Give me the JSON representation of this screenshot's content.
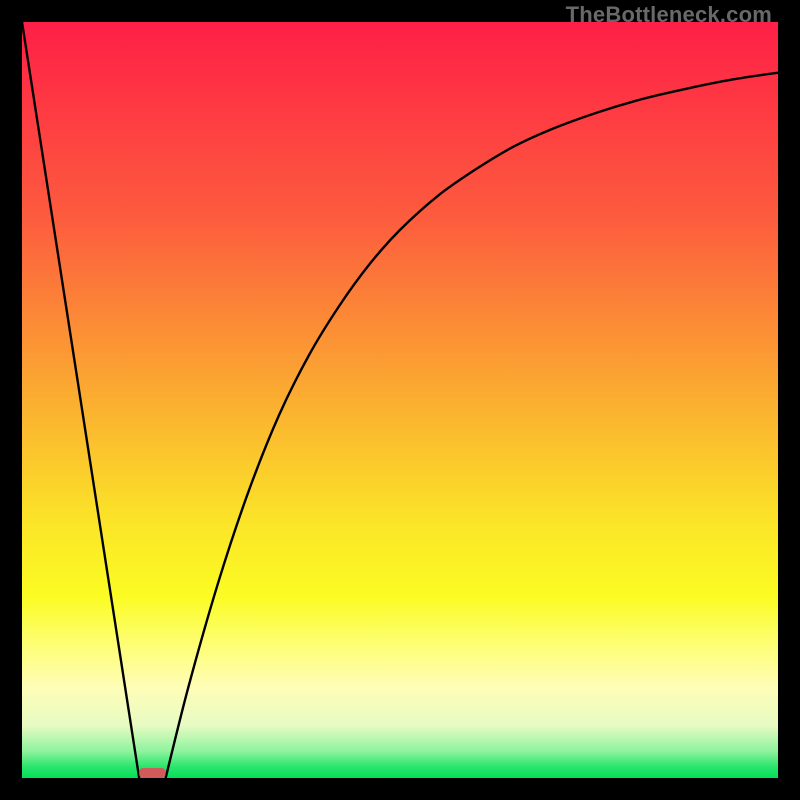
{
  "watermark": "TheBottleneck.com",
  "chart_data": {
    "type": "line",
    "title": "",
    "xlabel": "",
    "ylabel": "",
    "xlim": [
      0,
      100
    ],
    "ylim": [
      0,
      100
    ],
    "grid": false,
    "series": [
      {
        "name": "left-linear",
        "x": [
          0,
          15.5
        ],
        "values": [
          100,
          0
        ]
      },
      {
        "name": "right-curve",
        "x": [
          19,
          22,
          26,
          30,
          34,
          38,
          42,
          46,
          50,
          55,
          60,
          65,
          70,
          76,
          82,
          88,
          94,
          100
        ],
        "values": [
          0,
          12,
          26,
          38,
          48,
          56,
          62.5,
          68,
          72.5,
          77,
          80.5,
          83.5,
          85.8,
          88,
          89.8,
          91.2,
          92.4,
          93.3
        ]
      }
    ],
    "marker": {
      "name": "bottleneck-marker",
      "x_range": [
        15.5,
        19
      ],
      "y": 0,
      "color": "#d15a5a"
    },
    "background_gradient": {
      "stops": [
        {
          "offset": 0.0,
          "color": "#fe1f46"
        },
        {
          "offset": 0.26,
          "color": "#fd5c3e"
        },
        {
          "offset": 0.5,
          "color": "#fbae30"
        },
        {
          "offset": 0.66,
          "color": "#fbe428"
        },
        {
          "offset": 0.76,
          "color": "#fbfc23"
        },
        {
          "offset": 0.82,
          "color": "#fdfe70"
        },
        {
          "offset": 0.88,
          "color": "#fefdb7"
        },
        {
          "offset": 0.93,
          "color": "#e8fbc3"
        },
        {
          "offset": 0.965,
          "color": "#8df39d"
        },
        {
          "offset": 0.985,
          "color": "#2ae56d"
        },
        {
          "offset": 1.0,
          "color": "#04df57"
        }
      ]
    }
  }
}
